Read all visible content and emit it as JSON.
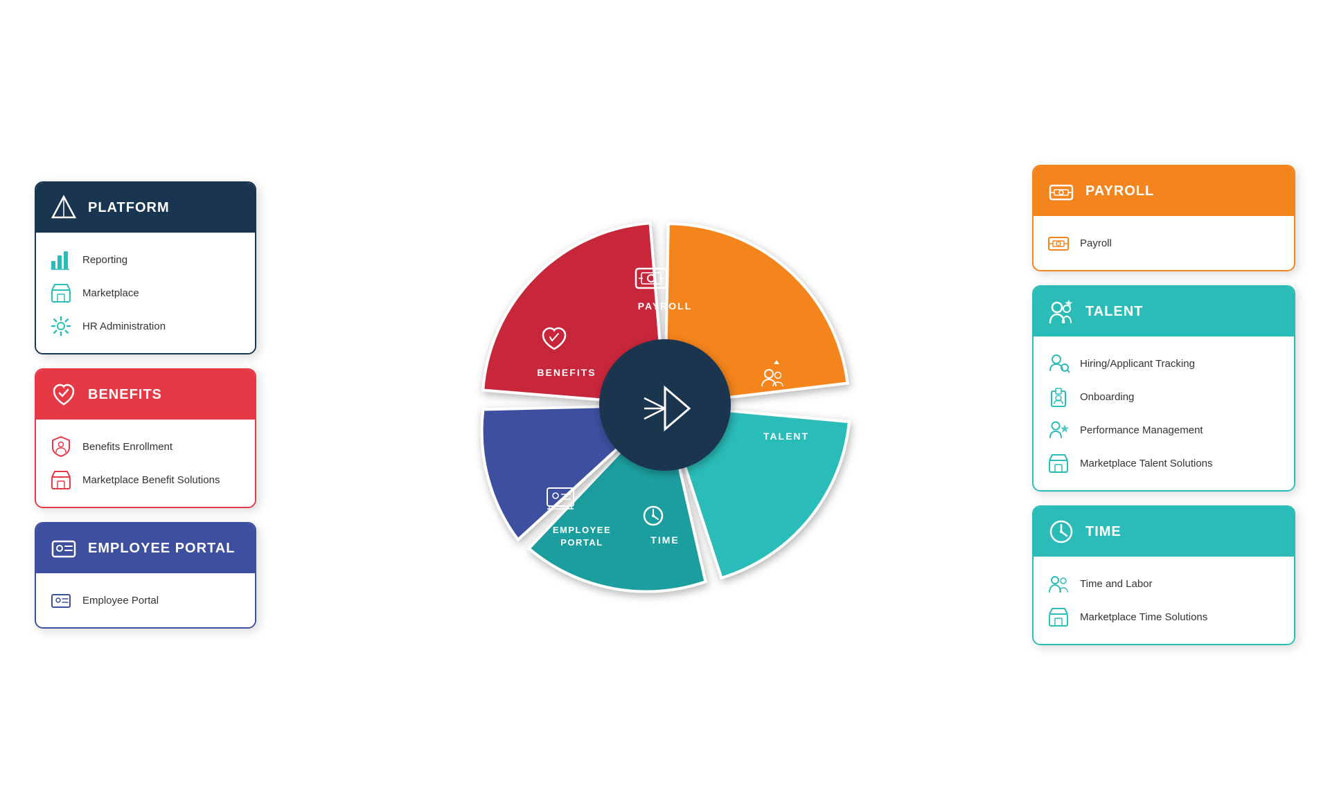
{
  "left_cards": [
    {
      "id": "platform",
      "header_label": "PLATFORM",
      "header_color": "#1a3550",
      "border_color": "#1a3550",
      "items": [
        {
          "label": "Reporting",
          "icon": "bar-chart-icon"
        },
        {
          "label": "Marketplace",
          "icon": "store-icon"
        },
        {
          "label": "HR Administration",
          "icon": "gear-icon"
        }
      ]
    },
    {
      "id": "benefits",
      "header_label": "BENEFITS",
      "header_color": "#e63946",
      "border_color": "#e63946",
      "items": [
        {
          "label": "Benefits Enrollment",
          "icon": "shield-icon"
        },
        {
          "label": "Marketplace Benefit Solutions",
          "icon": "store-icon"
        }
      ]
    },
    {
      "id": "employee-portal",
      "header_label": "EMPLOYEE PORTAL",
      "header_color": "#3d4f9e",
      "border_color": "#3d4f9e",
      "items": [
        {
          "label": "Employee Portal",
          "icon": "person-icon"
        }
      ]
    }
  ],
  "right_cards": [
    {
      "id": "payroll",
      "header_label": "PAYROLL",
      "header_color": "#f4841e",
      "border_color": "#f4841e",
      "items": [
        {
          "label": "Payroll",
          "icon": "money-icon"
        }
      ]
    },
    {
      "id": "talent",
      "header_label": "TALENT",
      "header_color": "#2bbcb8",
      "border_color": "#2bbcb8",
      "items": [
        {
          "label": "Hiring/Applicant Tracking",
          "icon": "search-person-icon"
        },
        {
          "label": "Onboarding",
          "icon": "clipboard-icon"
        },
        {
          "label": "Performance Management",
          "icon": "person-star-icon"
        },
        {
          "label": "Marketplace Talent Solutions",
          "icon": "store-icon"
        }
      ]
    },
    {
      "id": "time",
      "header_label": "TIME",
      "header_color": "#2bbcb8",
      "border_color": "#2bbcb8",
      "items": [
        {
          "label": "Time and Labor",
          "icon": "people-icon"
        },
        {
          "label": "Marketplace Time Solutions",
          "icon": "store-icon"
        }
      ]
    }
  ],
  "wheel": {
    "segments": [
      {
        "id": "payroll",
        "label": "PAYROLL",
        "color": "#f4841e"
      },
      {
        "id": "talent",
        "label": "TALENT",
        "color": "#2bbcb8"
      },
      {
        "id": "time",
        "label": "TIME",
        "color": "#1a9e9e"
      },
      {
        "id": "employee-portal",
        "label": "EMPLOYEE PORTAL",
        "color": "#3d4f9e"
      },
      {
        "id": "benefits",
        "label": "BENEFITS",
        "color": "#e63946"
      }
    ],
    "center_color": "#1a3550"
  }
}
